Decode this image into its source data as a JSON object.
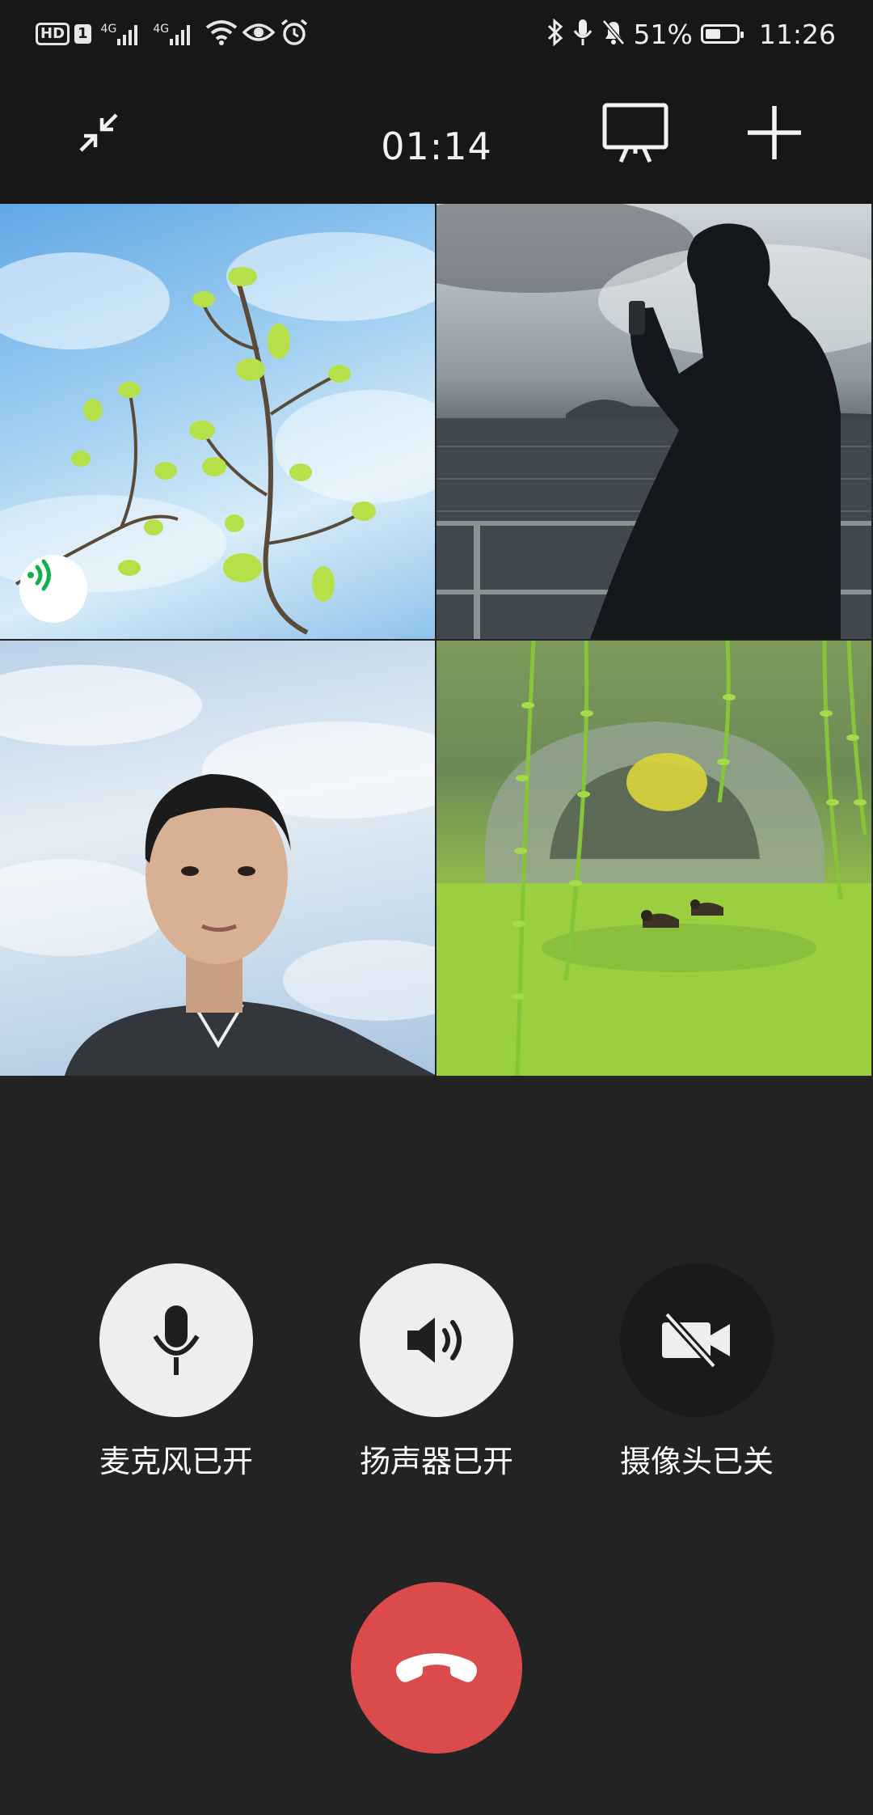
{
  "status_bar": {
    "hd_label": "HD",
    "sim_label": "1",
    "network_1": "4G",
    "network_2": "4G",
    "battery_text": "51%",
    "battery_level": 0.51,
    "time": "11:26",
    "icons": [
      "signal-icon",
      "wifi-icon",
      "eye-icon",
      "alarm-icon",
      "bluetooth-icon",
      "microphone-icon",
      "mute-notification-icon",
      "battery-icon"
    ]
  },
  "call": {
    "duration": "01:14",
    "icons": {
      "minimize": "minimize-icon",
      "screen_share": "screen-share-icon",
      "add_participant": "add-icon"
    }
  },
  "participants": [
    {
      "tile": "participant-1",
      "speaking": true
    },
    {
      "tile": "participant-2",
      "speaking": false
    },
    {
      "tile": "participant-3",
      "speaking": false
    },
    {
      "tile": "participant-4",
      "speaking": false
    }
  ],
  "controls": {
    "microphone": {
      "label": "麦克风已开",
      "icon": "microphone-icon",
      "state": "on"
    },
    "speaker": {
      "label": "扬声器已开",
      "icon": "speaker-icon",
      "state": "on"
    },
    "camera": {
      "label": "摄像头已关",
      "icon": "camera-off-icon",
      "state": "off"
    },
    "hangup": {
      "icon": "hang-up-icon"
    }
  },
  "colors": {
    "background": "#232323",
    "hangup": "#dc4b4b",
    "speaking_indicator": "#12b04a",
    "button_light": "#eeeeee",
    "button_dark": "#1a1a1a"
  }
}
